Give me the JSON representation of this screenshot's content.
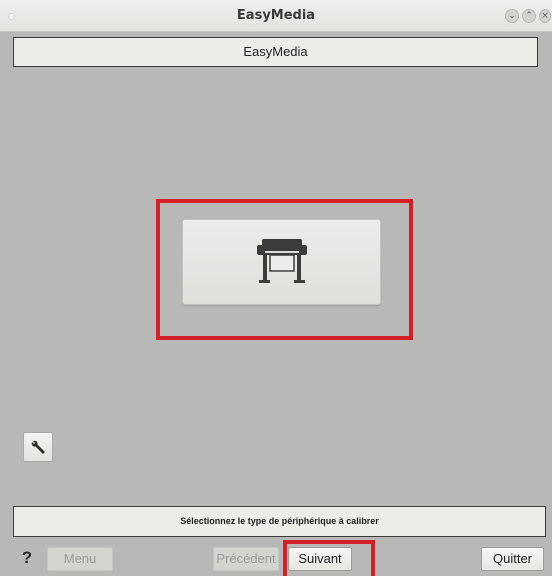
{
  "window": {
    "title": "EasyMedia",
    "controls": [
      "minimize-icon",
      "maximize-icon",
      "close-icon"
    ]
  },
  "header": {
    "title": "EasyMedia"
  },
  "main": {
    "device_types": [
      {
        "icon": "large-format-printer-icon",
        "selected": true
      }
    ],
    "tools_icon": "wrench-icon"
  },
  "status": {
    "message": "Sélectionnez le type de périphérique à calibrer"
  },
  "footer": {
    "help_label": "?",
    "menu_label": "Menu",
    "previous_label": "Précédent",
    "next_label": "Suivant",
    "quit_label": "Quitter"
  },
  "colors": {
    "highlight": "#d41f26",
    "background": "#b8b8b6",
    "panel": "#ecece9"
  }
}
